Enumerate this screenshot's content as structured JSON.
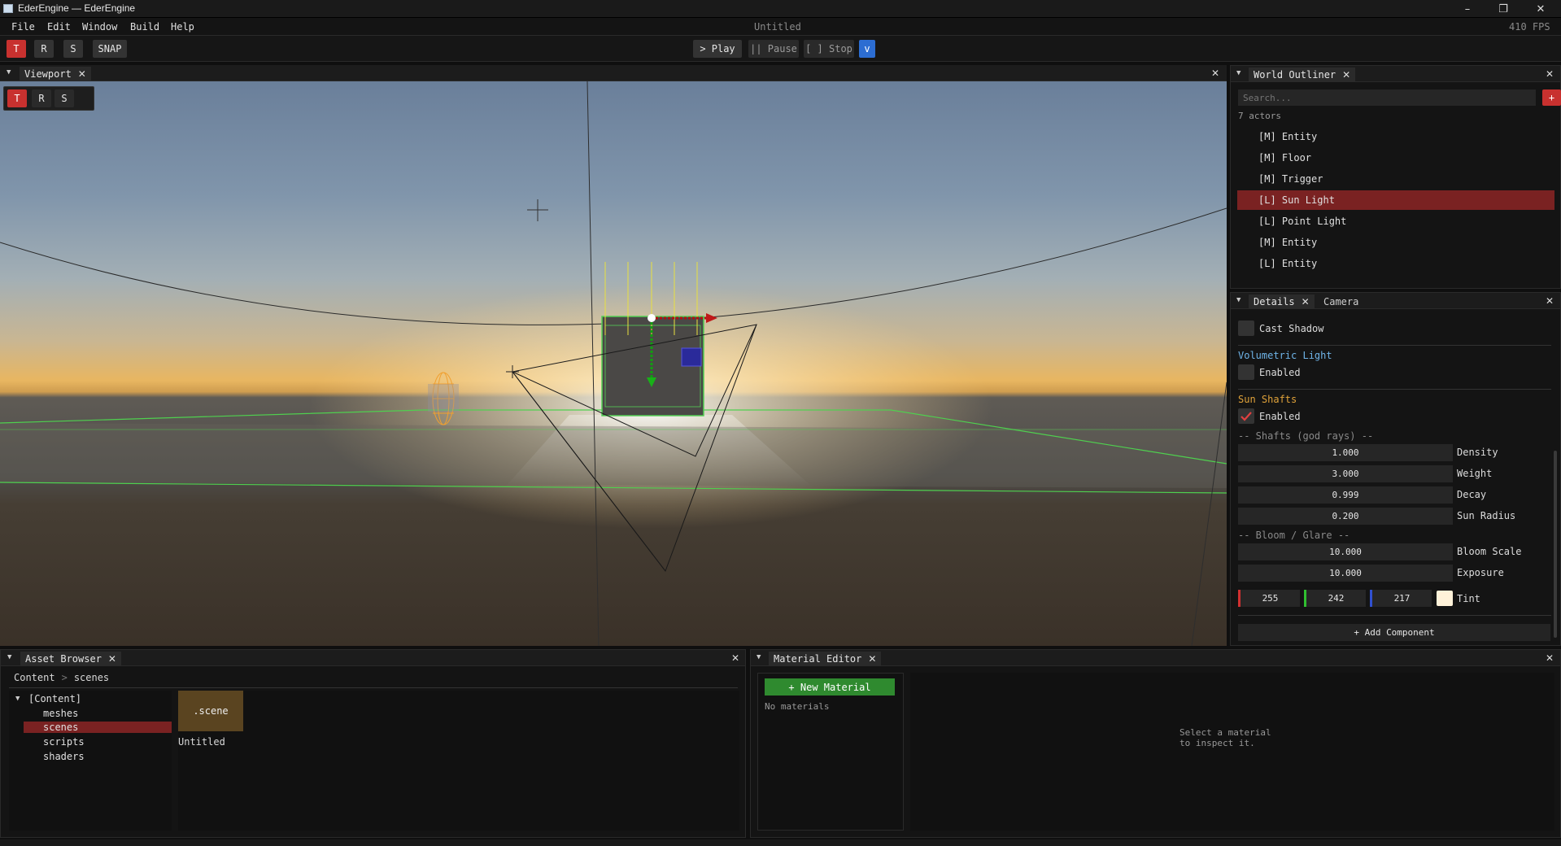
{
  "window": {
    "title": "EderEngine — EderEngine"
  },
  "menu": {
    "items": [
      "File",
      "Edit",
      "Window",
      "Build",
      "Help"
    ],
    "doc_title": "Untitled",
    "fps": "410 FPS"
  },
  "toolbar": {
    "t": "T",
    "r": "R",
    "s": "S",
    "snap": "SNAP",
    "play": "> Play",
    "pause": "|| Pause",
    "stop": "[ ] Stop",
    "more": "v"
  },
  "viewport": {
    "tab": "Viewport",
    "gizmo": [
      "T",
      "R",
      "S"
    ]
  },
  "outliner": {
    "tab": "World Outliner",
    "search_placeholder": "Search...",
    "add": "+",
    "count": "7 actors",
    "items": [
      "[M] Entity",
      "[M] Floor",
      "[M] Trigger",
      "[L] Sun Light",
      "[L] Point Light",
      "[M] Entity",
      "[L] Entity"
    ],
    "selected_index": 3
  },
  "details": {
    "tabs": [
      "Details",
      "Camera"
    ],
    "cast_shadow": "Cast Shadow",
    "volumetric_title": "Volumetric Light",
    "volumetric_enabled": "Enabled",
    "shafts_title": "Sun Shafts",
    "shafts_enabled": "Enabled",
    "shafts_sub": "-- Shafts (god rays) --",
    "density": {
      "value": "1.000",
      "label": "Density"
    },
    "weight": {
      "value": "3.000",
      "label": "Weight"
    },
    "decay": {
      "value": "0.999",
      "label": "Decay"
    },
    "sun_radius": {
      "value": "0.200",
      "label": "Sun Radius"
    },
    "bloom_sub": "-- Bloom / Glare --",
    "bloom_scale": {
      "value": "10.000",
      "label": "Bloom Scale"
    },
    "exposure": {
      "value": "10.000",
      "label": "Exposure"
    },
    "tint": {
      "r": "255",
      "g": "242",
      "b": "217",
      "label": "Tint",
      "color": "#fff2d9"
    },
    "add_component": "+ Add Component"
  },
  "asset_browser": {
    "tab": "Asset Browser",
    "breadcrumb": [
      "Content",
      ">",
      "scenes"
    ],
    "tree": [
      "[Content]",
      "meshes",
      "scenes",
      "scripts",
      "shaders"
    ],
    "selected_folder": "scenes",
    "file_ext": ".scene",
    "file_name": "Untitled"
  },
  "material_editor": {
    "tab": "Material Editor",
    "new_button": "+ New Material",
    "empty": "No materials",
    "hint_line1": "Select a material",
    "hint_line2": "to inspect it."
  },
  "colors": {
    "accent_red": "#c8312f",
    "selection": "#7a2222",
    "volumetric": "#6fb4e8",
    "shafts": "#e0a23a",
    "new_material": "#2f8a2f"
  }
}
